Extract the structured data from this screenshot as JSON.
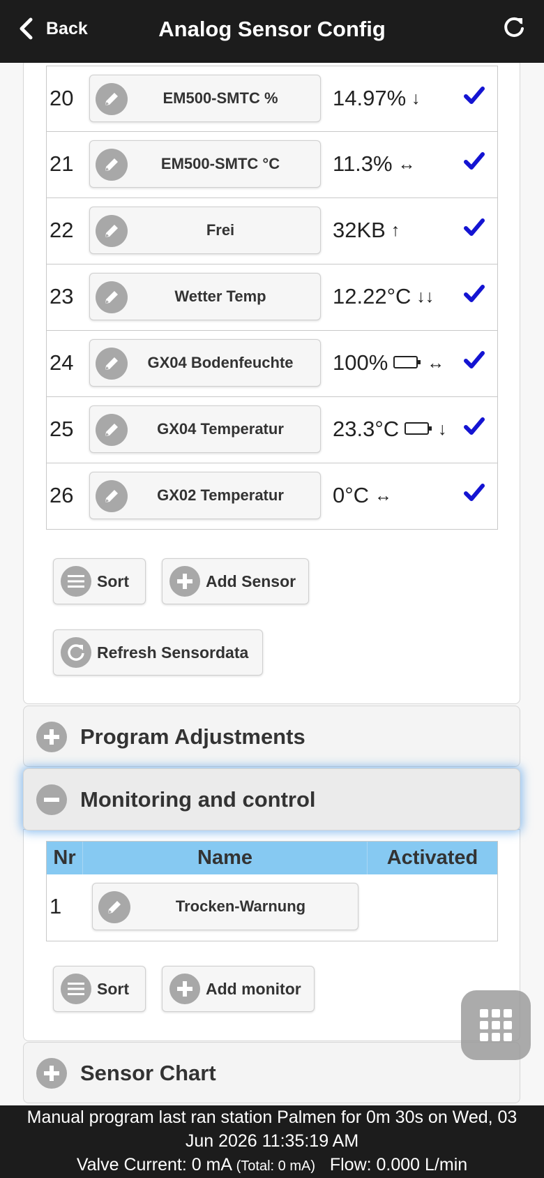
{
  "header": {
    "back_label": "Back",
    "title": "Analog Sensor Config"
  },
  "sensors": [
    {
      "nr": "20",
      "name": "EM500-SMTC %",
      "value": "14.97%",
      "trend": "↓",
      "battery": false,
      "checked": true
    },
    {
      "nr": "21",
      "name": "EM500-SMTC °C",
      "value": "11.3%",
      "trend": "↔",
      "battery": false,
      "checked": true
    },
    {
      "nr": "22",
      "name": "Frei",
      "value": "32KB",
      "trend": "↑",
      "battery": false,
      "checked": true
    },
    {
      "nr": "23",
      "name": "Wetter Temp",
      "value": "12.22°C",
      "trend": "↓↓",
      "battery": false,
      "checked": true
    },
    {
      "nr": "24",
      "name": "GX04 Bodenfeuchte",
      "value": "100%",
      "trend": "↔",
      "battery": true,
      "checked": true
    },
    {
      "nr": "25",
      "name": "GX04 Temperatur",
      "value": "23.3°C",
      "trend": "↓",
      "battery": true,
      "checked": true
    },
    {
      "nr": "26",
      "name": "GX02 Temperatur",
      "value": "0°C",
      "trend": "↔",
      "battery": false,
      "checked": true
    }
  ],
  "sensor_buttons": {
    "sort": "Sort",
    "add_sensor": "Add Sensor",
    "refresh": "Refresh Sensordata"
  },
  "sections": {
    "program_adjustments": "Program Adjustments",
    "monitoring": "Monitoring and control",
    "sensor_chart": "Sensor Chart"
  },
  "monitor_table": {
    "headers": [
      "Nr",
      "Name",
      "Activated"
    ],
    "rows": [
      {
        "nr": "1",
        "name": "Trocken-Warnung",
        "activated": ""
      }
    ]
  },
  "monitor_buttons": {
    "sort": "Sort",
    "add_monitor": "Add monitor"
  },
  "footer": {
    "line1": "Manual program last ran station Palmen for 0m 30s on Wed, 03",
    "line2": "Jun 2026 11:35:19 AM",
    "valve_label": "Valve Current: 0 mA",
    "valve_total": "(Total: 0 mA)",
    "flow": "Flow: 0.000 L/min"
  },
  "colors": {
    "header_bg": "#1c1c1c",
    "table_header": "#86c9f2",
    "check": "#1414d2",
    "icon_circle": "#a8a8a8"
  }
}
